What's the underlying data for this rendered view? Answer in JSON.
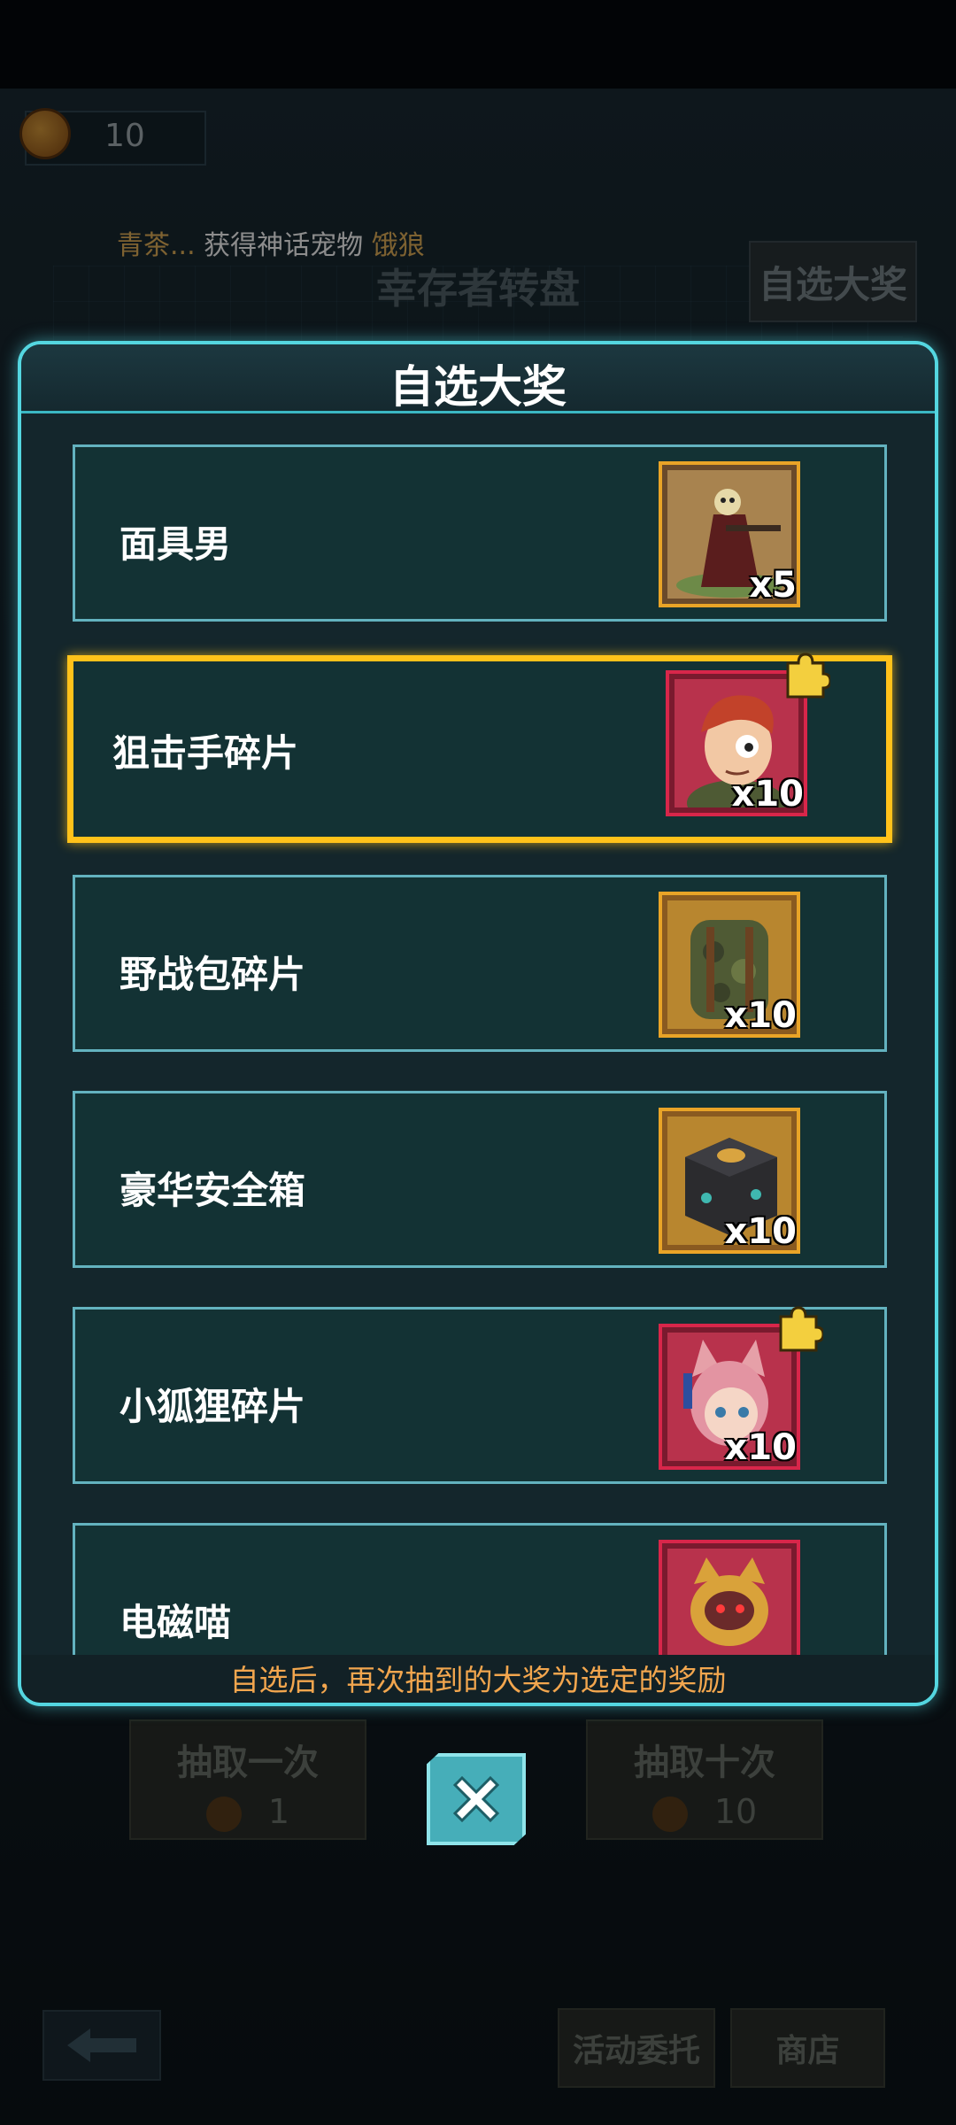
{
  "background": {
    "coin_count": "10",
    "ticker": {
      "player": "青茶...",
      "message": "获得神话宠物",
      "pet": "饿狼"
    },
    "screen_title": "幸存者转盘",
    "pick_prize_button": "自选大奖",
    "draw_once": {
      "label": "抽取一次",
      "cost": "1"
    },
    "draw_ten": {
      "label": "抽取十次",
      "cost": "10"
    },
    "activity_button": "活动委托",
    "shop_button": "商店"
  },
  "modal": {
    "title": "自选大奖",
    "footer_note": "自选后，再次抽到的大奖为选定的奖励",
    "items": [
      {
        "label": "面具男",
        "count": "x5",
        "icon": "masked-man-icon",
        "fragment": false
      },
      {
        "label": "狙击手碎片",
        "count": "x10",
        "icon": "sniper-portrait-icon",
        "fragment": true,
        "selected": true
      },
      {
        "label": "野战包碎片",
        "count": "x10",
        "icon": "backpack-icon",
        "fragment": false
      },
      {
        "label": "豪华安全箱",
        "count": "x10",
        "icon": "safe-box-icon",
        "fragment": false
      },
      {
        "label": "小狐狸碎片",
        "count": "x10",
        "icon": "fox-girl-icon",
        "fragment": true
      },
      {
        "label": "电磁喵",
        "count": "",
        "icon": "robot-cat-icon",
        "fragment": false
      }
    ]
  },
  "colors": {
    "modal_border": "#54d6e0",
    "selected_border": "#ffc21a",
    "footer_text": "#f2a64e",
    "gold_frame": "#e9a427",
    "red_frame": "#d8264a"
  }
}
